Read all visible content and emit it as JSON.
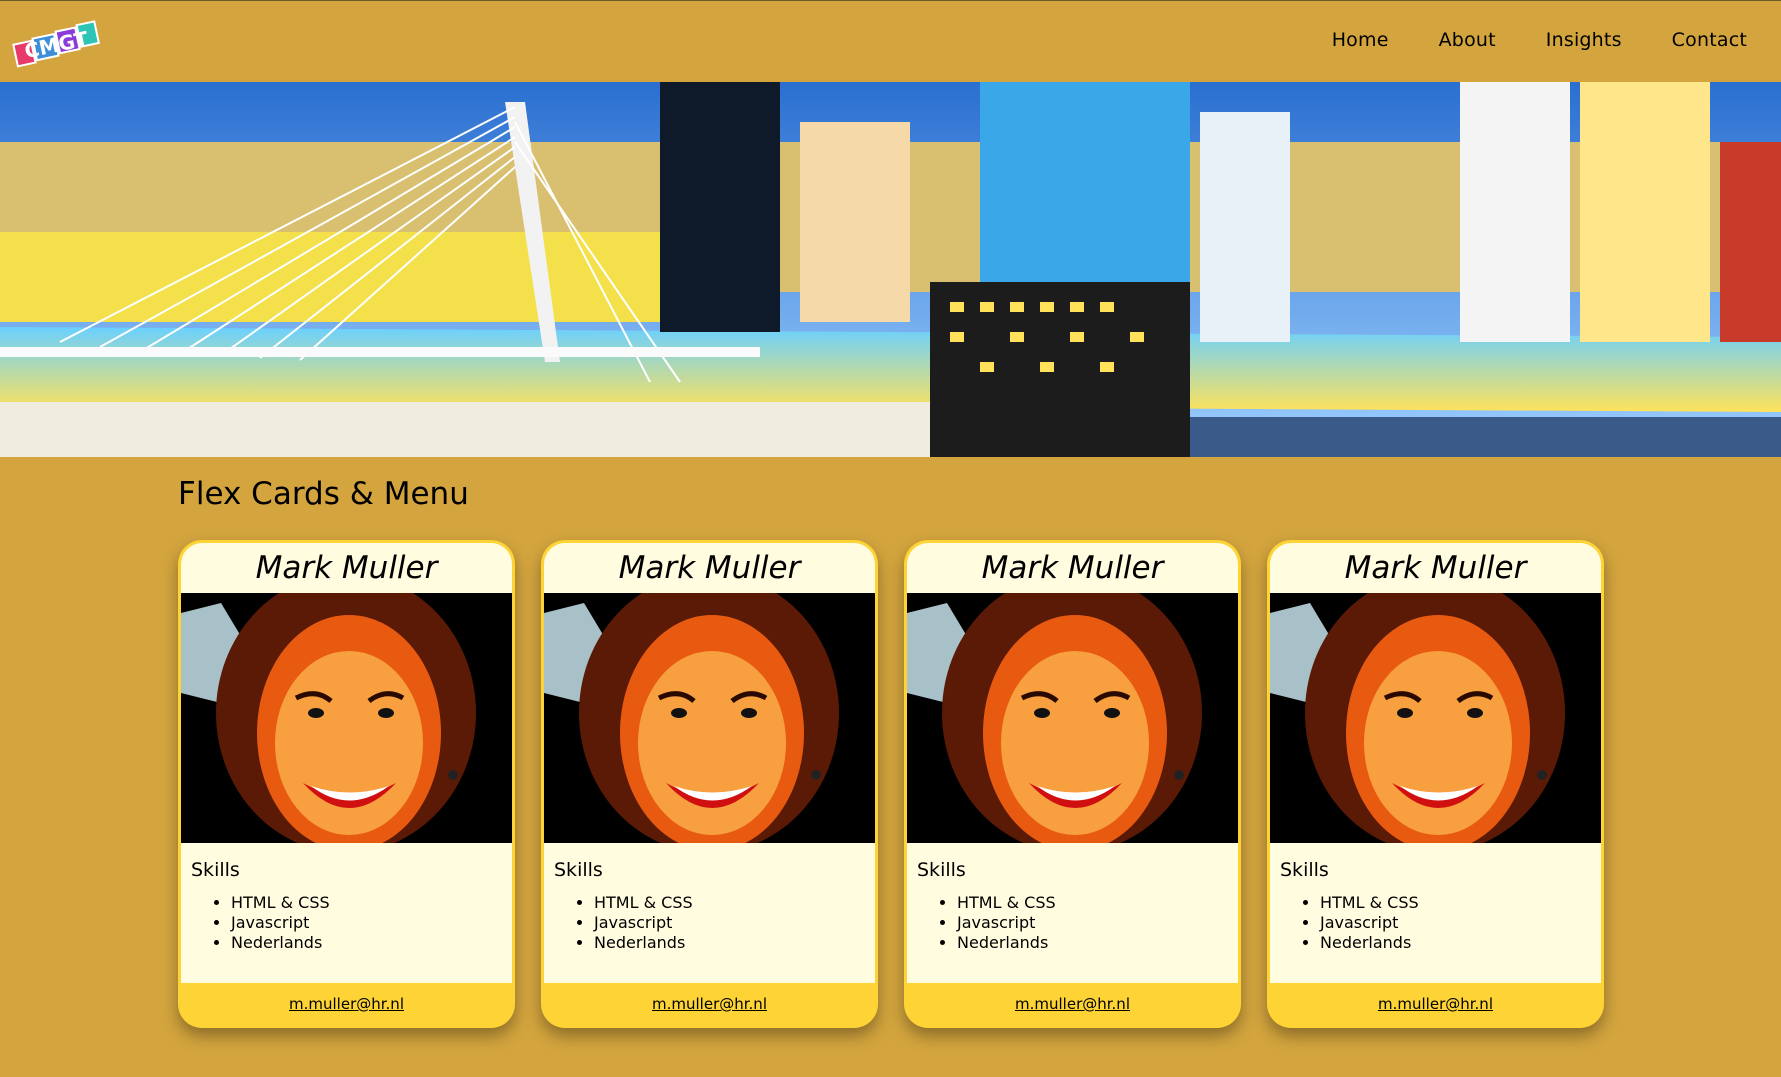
{
  "header": {
    "logo_text": "CMGT",
    "nav": [
      {
        "label": "Home"
      },
      {
        "label": "About"
      },
      {
        "label": "Insights"
      },
      {
        "label": "Contact"
      }
    ]
  },
  "hero": {
    "image": "rotterdam-skyline-night"
  },
  "main": {
    "title": "Flex Cards & Menu",
    "cards": [
      {
        "name": "Mark Muller",
        "photo": "smiling-woman-portrait",
        "skills_title": "Skills",
        "skills": [
          "HTML & CSS",
          "Javascript",
          "Nederlands"
        ],
        "email": "m.muller@hr.nl"
      },
      {
        "name": "Mark Muller",
        "photo": "smiling-woman-portrait",
        "skills_title": "Skills",
        "skills": [
          "HTML & CSS",
          "Javascript",
          "Nederlands"
        ],
        "email": "m.muller@hr.nl"
      },
      {
        "name": "Mark Muller",
        "photo": "smiling-woman-portrait",
        "skills_title": "Skills",
        "skills": [
          "HTML & CSS",
          "Javascript",
          "Nederlands"
        ],
        "email": "m.muller@hr.nl"
      },
      {
        "name": "Mark Muller",
        "photo": "smiling-woman-portrait",
        "skills_title": "Skills",
        "skills": [
          "HTML & CSS",
          "Javascript",
          "Nederlands"
        ],
        "email": "m.muller@hr.nl"
      }
    ]
  },
  "colors": {
    "page_background": "#d4a53e",
    "card_border": "#fdd335",
    "card_background": "#fffce0"
  }
}
